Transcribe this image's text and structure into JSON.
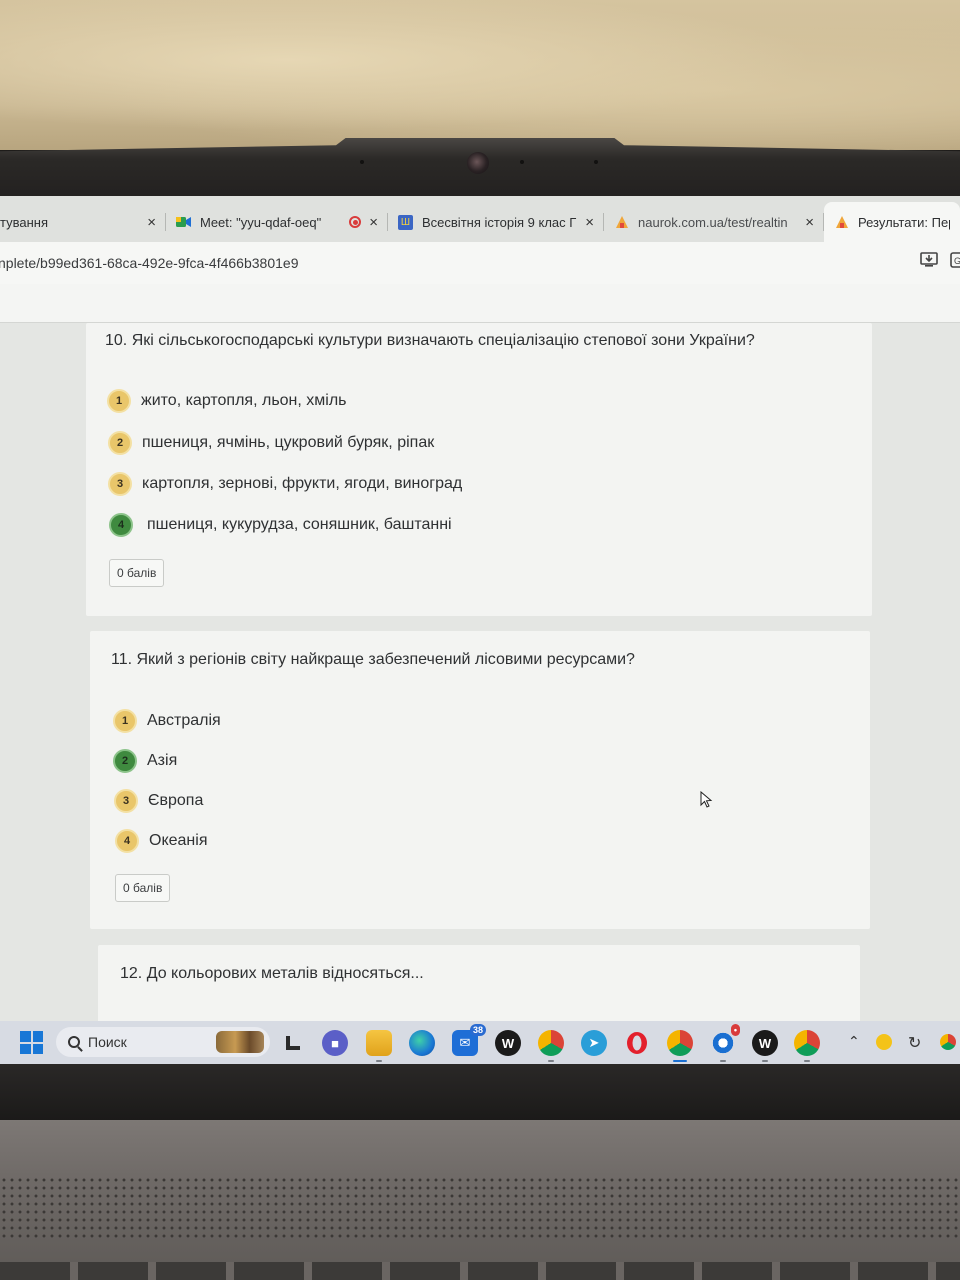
{
  "browser": {
    "tabs": [
      {
        "title": "тування",
        "close": "×",
        "favicon": "doc-icon"
      },
      {
        "title": "Meet: \"yyu-qdaf-oeq\"",
        "close": "×",
        "favicon": "meet-icon",
        "recording": true
      },
      {
        "title": "Всесвітня історія 9 клас Г",
        "close": "×",
        "favicon": "ua-flag-icon"
      },
      {
        "title": "naurok.com.ua/test/realtin",
        "close": "×",
        "favicon": "naurok-icon"
      },
      {
        "title": "Результати: Перви",
        "favicon": "naurok-icon",
        "active": true
      }
    ],
    "url": "nplete/b99ed361-68ca-492e-9fca-4f466b3801e9"
  },
  "questions": [
    {
      "title": "10. Які сільськогосподарські культури визначають спеціалізацію степової зони України?",
      "answers": [
        {
          "num": "1",
          "text": "жито, картопля, льон, хміль",
          "status": "yellow"
        },
        {
          "num": "2",
          "text": "пшениця, ячмінь, цукровий буряк, ріпак",
          "status": "yellow"
        },
        {
          "num": "3",
          "text": "картопля, зернові, фрукти, ягоди, виноград",
          "status": "yellow"
        },
        {
          "num": "4",
          "text": "пшениця, кукурудза, соняшник, баштанні",
          "status": "green"
        }
      ],
      "points": "0 балів"
    },
    {
      "title": "11. Який з регіонів світу найкраще забезпечений лісовими ресурсами?",
      "answers": [
        {
          "num": "1",
          "text": "Австралія",
          "status": "yellow"
        },
        {
          "num": "2",
          "text": "Азія",
          "status": "green"
        },
        {
          "num": "3",
          "text": "Європа",
          "status": "yellow"
        },
        {
          "num": "4",
          "text": "Океанія",
          "status": "yellow"
        }
      ],
      "points": "0 балів"
    },
    {
      "title": "12. До кольорових металів відносяться..."
    }
  ],
  "taskbar": {
    "search_placeholder": "Поиск",
    "mail_badge": "38",
    "apps": [
      "start-icon",
      "search-icon",
      "file-icon",
      "teams-icon",
      "explorer-icon",
      "edge-icon",
      "mail-icon",
      "w-app-icon",
      "chrome-icon",
      "telegram-icon",
      "opera-icon",
      "chrome-icon",
      "w-app-icon",
      "chrome-icon"
    ],
    "tray": [
      "chevron-up-icon",
      "norton-icon",
      "sync-icon",
      "chrome-icon"
    ]
  },
  "colors": {
    "answer_wrong": "#e9c66a",
    "answer_correct": "#3f8a3f",
    "win_blue": "#1877d6"
  }
}
